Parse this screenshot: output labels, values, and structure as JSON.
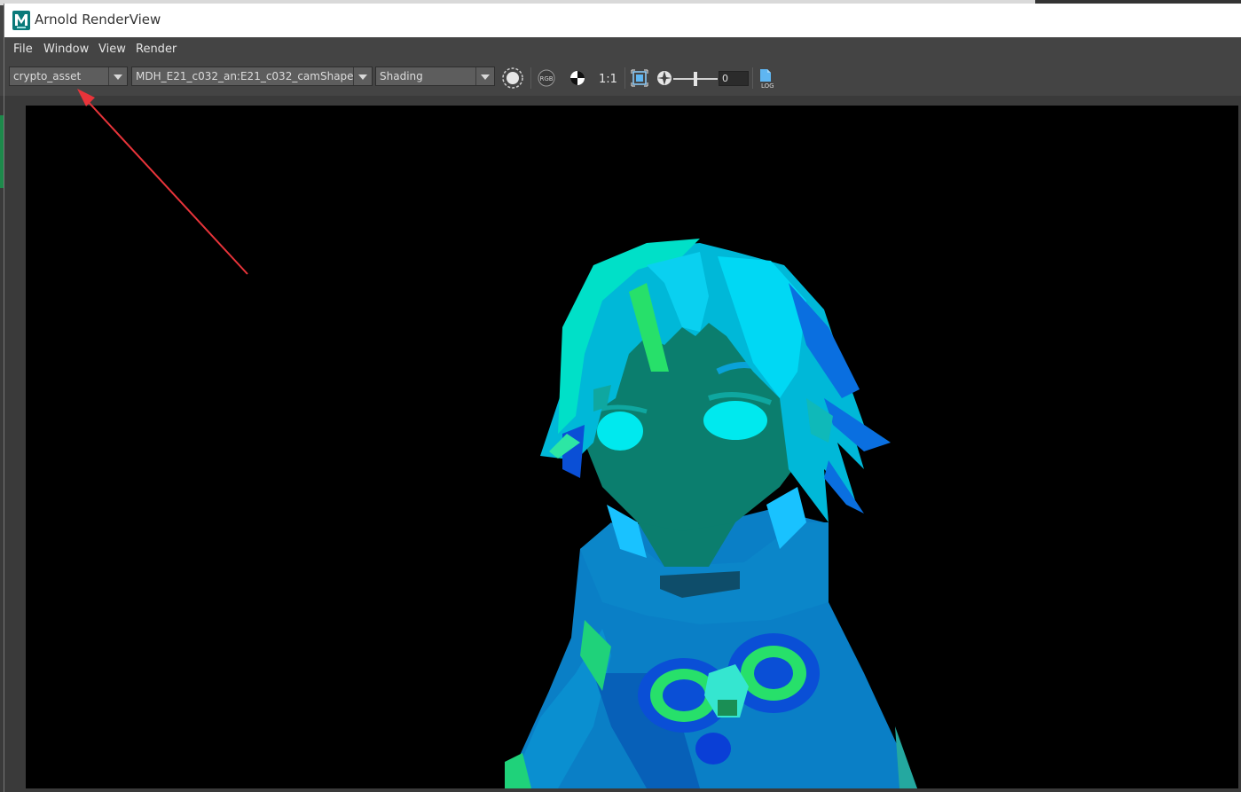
{
  "window": {
    "title": "Arnold RenderView",
    "icon": "maya-icon"
  },
  "menubar": {
    "items": [
      "File",
      "Window",
      "View",
      "Render"
    ]
  },
  "toolbar": {
    "aov_select": "crypto_asset",
    "camera_select": "MDH_E21_c032_an:E21_c032_camShape",
    "shading_select": "Shading",
    "one_to_one": "1:1",
    "exposure_value": "0",
    "icons": [
      "render-region-icon",
      "rgb-channel-icon",
      "color-correct-icon",
      "fit-to-frame-icon",
      "exposure-icon",
      "log-icon"
    ]
  },
  "colors": {
    "background": "#444444",
    "viewport": "#000000",
    "annotation_arrow": "#e8343a"
  }
}
